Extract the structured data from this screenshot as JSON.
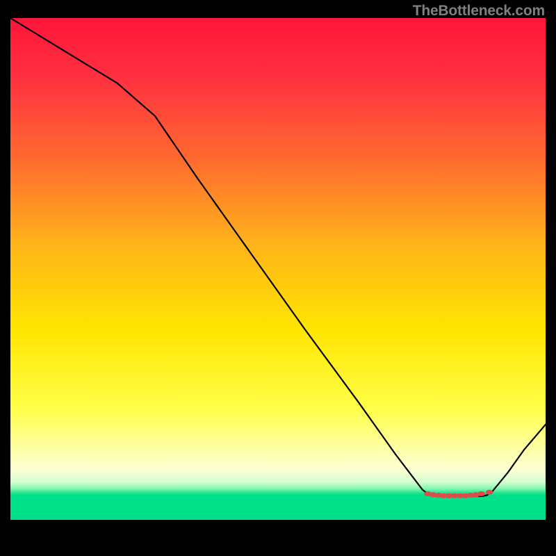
{
  "watermark": "TheBottleneck.com",
  "chart_data": {
    "type": "line",
    "title": "",
    "xlabel": "",
    "ylabel": "",
    "xlim": [
      0,
      100
    ],
    "ylim": [
      0,
      100
    ],
    "grid": false,
    "gradient_stops": [
      {
        "offset": 0,
        "color": "#ff153a"
      },
      {
        "offset": 12,
        "color": "#ff3140"
      },
      {
        "offset": 28,
        "color": "#ff6a2f"
      },
      {
        "offset": 45,
        "color": "#ffb31a"
      },
      {
        "offset": 62,
        "color": "#ffe500"
      },
      {
        "offset": 78,
        "color": "#ffff4a"
      },
      {
        "offset": 86,
        "color": "#ffffa8"
      },
      {
        "offset": 90,
        "color": "#fbffd2"
      },
      {
        "offset": 92.5,
        "color": "#d4ffd0"
      },
      {
        "offset": 93.8,
        "color": "#82f5b0"
      },
      {
        "offset": 94.6,
        "color": "#23e58f"
      },
      {
        "offset": 95.2,
        "color": "#00e08a"
      }
    ],
    "series": [
      {
        "name": "bottleneck-curve",
        "color": "#000000",
        "x": [
          0,
          10,
          20,
          27,
          35,
          45,
          55,
          65,
          72,
          77,
          78,
          80,
          82,
          84,
          86,
          88,
          89,
          90,
          93,
          96,
          100
        ],
        "y": [
          100,
          93.5,
          87,
          80.5,
          68,
          53,
          38,
          23.5,
          13,
          6,
          5.2,
          4.8,
          4.7,
          4.7,
          4.7,
          4.7,
          4.9,
          5.6,
          9.5,
          14,
          19
        ]
      }
    ],
    "markers": {
      "name": "optimal-range",
      "color": "#e04a4a",
      "points": [
        {
          "x": 78,
          "y": 5.2
        },
        {
          "x": 79,
          "y": 5.0
        },
        {
          "x": 80,
          "y": 4.9
        },
        {
          "x": 81,
          "y": 4.8
        },
        {
          "x": 82,
          "y": 4.8
        },
        {
          "x": 83,
          "y": 4.8
        },
        {
          "x": 84,
          "y": 4.8
        },
        {
          "x": 85,
          "y": 4.8
        },
        {
          "x": 86,
          "y": 4.9
        },
        {
          "x": 87,
          "y": 5.0
        },
        {
          "x": 88,
          "y": 5.2
        },
        {
          "x": 89.5,
          "y": 5.5
        }
      ]
    }
  }
}
